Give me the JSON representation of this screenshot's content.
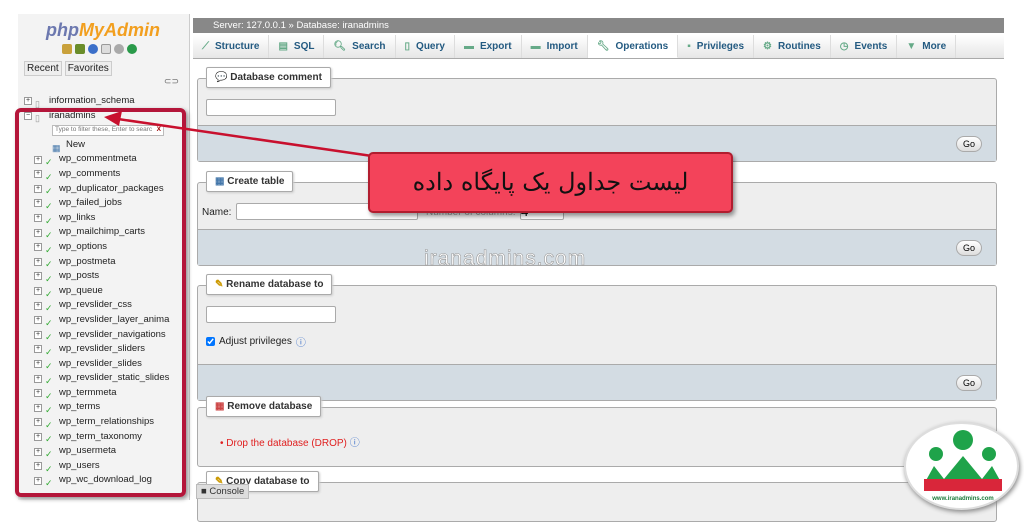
{
  "sidebar": {
    "logo_php": "php",
    "logo_myadmin": "MyAdmin",
    "recent": "Recent",
    "favorites": "Favorites",
    "databases": [
      {
        "name": "information_schema"
      },
      {
        "name": "iranadmins"
      }
    ],
    "filter_placeholder": "Type to filter these, Enter to searc",
    "filter_clear": "X",
    "new_label": "New",
    "tables": [
      "wp_commentmeta",
      "wp_comments",
      "wp_duplicator_packages",
      "wp_failed_jobs",
      "wp_links",
      "wp_mailchimp_carts",
      "wp_options",
      "wp_postmeta",
      "wp_posts",
      "wp_queue",
      "wp_revslider_css",
      "wp_revslider_layer_anima",
      "wp_revslider_navigations",
      "wp_revslider_sliders",
      "wp_revslider_slides",
      "wp_revslider_static_slides",
      "wp_termmeta",
      "wp_terms",
      "wp_term_relationships",
      "wp_term_taxonomy",
      "wp_usermeta",
      "wp_users",
      "wp_wc_download_log"
    ]
  },
  "breadcrumb": "Server: 127.0.0.1 » Database: iranadmins",
  "tabs": [
    {
      "label": "Structure",
      "icon": "structure-icon"
    },
    {
      "label": "SQL",
      "icon": "sql-icon"
    },
    {
      "label": "Search",
      "icon": "search-icon"
    },
    {
      "label": "Query",
      "icon": "query-icon"
    },
    {
      "label": "Export",
      "icon": "export-icon"
    },
    {
      "label": "Import",
      "icon": "import-icon"
    },
    {
      "label": "Operations",
      "icon": "wrench-icon",
      "active": true
    },
    {
      "label": "Privileges",
      "icon": "privileges-icon"
    },
    {
      "label": "Routines",
      "icon": "routines-icon"
    },
    {
      "label": "Events",
      "icon": "clock-icon"
    },
    {
      "label": "More",
      "icon": "caret-down-icon"
    }
  ],
  "sections": {
    "comment": {
      "title": "Database comment",
      "go": "Go",
      "value": ""
    },
    "create": {
      "title": "Create table",
      "name_label": "Name:",
      "cols_label": "Number of columns:",
      "cols_value": "4",
      "go": "Go"
    },
    "rename": {
      "title": "Rename database to",
      "adjust": "Adjust privileges",
      "adjust_checked": true,
      "go": "Go"
    },
    "remove": {
      "title": "Remove database",
      "drop": "Drop the database (DROP)"
    },
    "copy": {
      "title": "Copy database to"
    }
  },
  "console": "Console",
  "annotation": "لیست جداول یک پایگاه داده",
  "watermark": "iranadmins.com",
  "badge_text": "www.iranadmins.com",
  "colors": {
    "accent": "#235a81",
    "annotation": "#f3435a",
    "outline": "#b4163a",
    "drop_link": "#e02020"
  }
}
